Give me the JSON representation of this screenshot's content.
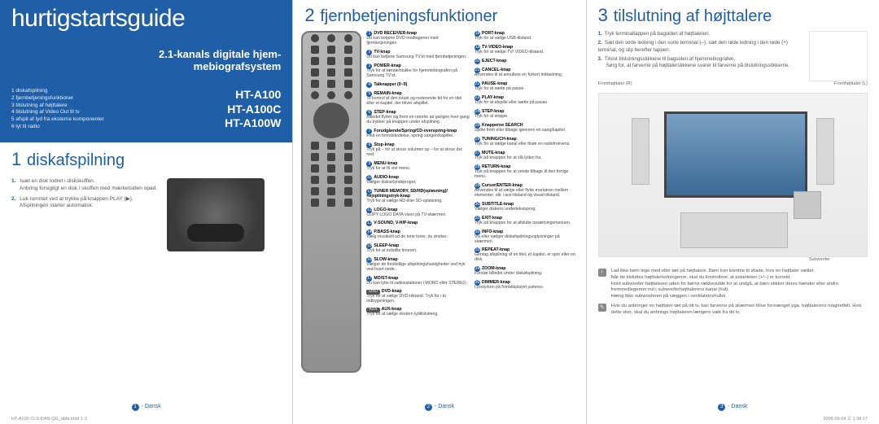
{
  "panel1": {
    "guide_title": "hurtigstartsguide",
    "product_subtitle_l1": "2.1-kanals digitale hjem-",
    "product_subtitle_l2": "mebiografsystem",
    "models": [
      "HT-A100",
      "HT-A100C",
      "HT-A100W"
    ],
    "toc": [
      "1 diskafspilning",
      "2 fjernbetjeningsfunktioner",
      "3 tilslutning af højttalere",
      "4 tilslutning af Video Out til tv",
      "5 afspil af lyd fra eksterne komponenter",
      "6 lyt til radio"
    ],
    "section_number": "1",
    "section_title": "diskafspilning",
    "steps": [
      {
        "num": "1.",
        "text": "Isæt en disk lodret i diskskuffen.",
        "sub": "Anbring forsigtigt en disk i skuffen med mærketsiden opad."
      },
      {
        "num": "2.",
        "text": "Luk rummet ved at trykke på knappen PLAY (▶).",
        "sub": "Afspilningen starter automatisk."
      }
    ],
    "footer_page": "1",
    "footer_lang": "Dansk",
    "doc_footer_l": "HT-A100 CLS-DAN-QG_abbr.indd   1-3",
    "doc_footer_r": "2009-09-08   오 1:38:17"
  },
  "panel2": {
    "section_number": "2",
    "section_title": "fjernbetjeningsfunktioner",
    "left_funcs": [
      {
        "n": "1",
        "name": "DVD RECEIVER-knap",
        "desc": "Du kan betjene DVD-modtageren med fjernbetjeningen."
      },
      {
        "n": "2",
        "name": "TV-knap",
        "desc": "Du kan betjene Samsung TV'et med fjernbetjeningen."
      },
      {
        "n": "3",
        "name": "POWER-knap",
        "desc": "Tryk for at tænde/slukke for hjemmebiografen på Samsung TV'et."
      },
      {
        "n": "4",
        "name": "Talknapper (0~9)",
        "desc": ""
      },
      {
        "n": "5",
        "name": "REMAIN-knap",
        "desc": "Til kontrol af den totale og resterende tid for en titel eller et kapitel, der bliver afspillet."
      },
      {
        "n": "6",
        "name": "STEP-knap",
        "desc": "Billedet flytter sig frem en ramme ad gangen hver gang du trykker på knappen under afspilning."
      },
      {
        "n": "7",
        "name": "Forudgående/Spring/CD-overspring-knap",
        "desc": "Find en forindskodelse, spring sangen/kapitlet."
      },
      {
        "n": "8",
        "name": "Stop-knap",
        "desc": "Tryk på – for at skrue volumen op – for at skrue det ned."
      },
      {
        "n": "9",
        "name": "MENU-knap",
        "desc": "Tryk for at få vist menu."
      },
      {
        "n": "10",
        "name": "AUDIO-knap",
        "desc": "Vælger diskselyndsproget."
      },
      {
        "n": "11",
        "name": "TUNER MEMORY, SD/HD(opløsning)/ hejspilningstryk-knap",
        "desc": "Tryk for at vælge HD eller SD-opløsning."
      },
      {
        "n": "12",
        "name": "LOGO-knap",
        "desc": "COPY LOGO DATA vises på TV-skærmen."
      },
      {
        "n": "13",
        "name": "V-SOUND, V-H/P-knap",
        "desc": ""
      },
      {
        "n": "14",
        "name": "P.BASS-knap",
        "desc": "Vælg musikstil ud de tone toner, du ønsker."
      },
      {
        "n": "15",
        "name": "SLEEP-knap",
        "desc": "Tryk for at indstille timeren."
      },
      {
        "n": "16",
        "name": "SLOW-knap",
        "desc": "Vælger de forskellige afspilningshastigheder ved tryk ved hvert nede."
      },
      {
        "n": "17",
        "name": "MO/ST-knap",
        "desc": "Du kan lytte til radiosstationer i MONO eller STEREO."
      },
      {
        "tag": "DVD",
        "name": "DVD-knap",
        "desc": "Tryk for at vælge DVD-tilstand. Tryk for i to indbygsningen."
      },
      {
        "tag": "AUX",
        "name": "AUX-knap",
        "desc": "Tryk for at vælge ekstern lydtilslutning."
      }
    ],
    "right_funcs": [
      {
        "n": "18",
        "name": "PORT-knap",
        "desc": "Tryk for at vælge USB-tilstand."
      },
      {
        "n": "19",
        "name": "TV-VIDEO-knap",
        "desc": "Tryk for at vælge TV/ VIDEO-tilstand."
      },
      {
        "n": "20",
        "name": "EJECT-knap",
        "desc": ""
      },
      {
        "n": "21",
        "name": "CANCEL-knap",
        "desc": "Anvendes til at annullere en forkert indtastning."
      },
      {
        "n": "22",
        "name": "PAUSE-knap",
        "desc": "Tryk for at sætte på pause."
      },
      {
        "n": "23",
        "name": "PLAY-knap",
        "desc": "Tryk for at afspille eller sætte på pause."
      },
      {
        "n": "24",
        "name": "STEP-knap",
        "desc": "Tryk for at stoppe."
      },
      {
        "n": "25",
        "name": "Knapperne SEARCH",
        "desc": "Spole frem eller tilbage igennem en sang/kapitel."
      },
      {
        "n": "26",
        "name": "TUNING/CH-knap",
        "desc": "Tryk for at vælge kanal eller finde en radiofrekvens."
      },
      {
        "n": "27",
        "name": "MUTE-knap",
        "desc": "Tryk på knappen for at slå lyden fra."
      },
      {
        "n": "28",
        "name": "RETURN-knap",
        "desc": "Tryk på knappen for at vende tilbage til den forrige menu."
      },
      {
        "n": "29",
        "name": "Cursor/ENTER-knap",
        "desc": "Anvendes til at vælge eller flytte markøren mellem elementer, når i aux-tilstand og visuel-tilstand."
      },
      {
        "n": "30",
        "name": "SUBTITLE-knap",
        "desc": "Vælger diskens undertekstsprog."
      },
      {
        "n": "31",
        "name": "EXIT-knap",
        "desc": "Tryk på knappen for at afslutte opsætningsmenuen."
      },
      {
        "n": "32",
        "name": "INFO-knap",
        "desc": "Vis eller vælger diskafspilningsoplysninger på skærmen."
      },
      {
        "n": "33",
        "name": "REPEAT-knap",
        "desc": "Gentag afspilning af en titel, et kapitel, et spor eller en disk."
      },
      {
        "n": "34",
        "name": "ZOOM-knap",
        "desc": "Forstør billedet under diskafspilning."
      },
      {
        "n": "35",
        "name": "DIMMER-knap",
        "desc": "Lysstyrken på frontdisplayet justeres."
      }
    ],
    "footer_page": "2",
    "footer_lang": "Dansk"
  },
  "panel3": {
    "section_number": "3",
    "section_title": "tilslutning af højttalere",
    "steps": [
      {
        "num": "1.",
        "text": "Tryk terminaltappen på bagsiden af højttaleren."
      },
      {
        "num": "2.",
        "text": "Sæt den sorte ledning i den sorte terminal (–), sæt den røde ledning i den røde (+) terminal, og slip herefter tappen."
      },
      {
        "num": "3.",
        "text": "Tilslut tilslutningsstikkene til bagsiden af hjemmebiografen.",
        "sub": "Sørg for, at farverne på højttalerstikkene svarer til farverne på tilslutningsstikkerne."
      }
    ],
    "diagram_labels": {
      "fl": "Fronthøjttaler (R)",
      "fr": "Fronthøjttaler (L)",
      "sub": "Subwoofer"
    },
    "notes": [
      {
        "icon": "!",
        "items": [
          "Lad ikke børn lege med eller tæt på højttalere. Børn kan komme til skade, hvis en højttaler vælter.",
          "Når de tilsluttes højttalerledningerne, skal du kontrollere, at polariteten (+/–) er korrekt.",
          "Hold subwoofer-højttaleren uden for børns rækkevidde for at undgå, at børn stikker deres hænder eller andre fremmedlegemer ind i subwooferhøjttalerens kanal (hul).",
          "Hæng ikke subwooferen på væggen i ventilationshullet."
        ]
      },
      {
        "icon": "✎",
        "items": [
          "Hvis du anbringer en højttaler tæt på dit tv, kan farverne på skærmen blive forvrænget pga. højttalerens magnetfelt. Hvis dette sker, skal du anbringe højttaleren længere væk fra dit tv."
        ]
      }
    ],
    "footer_page": "3",
    "footer_lang": "Dansk"
  }
}
